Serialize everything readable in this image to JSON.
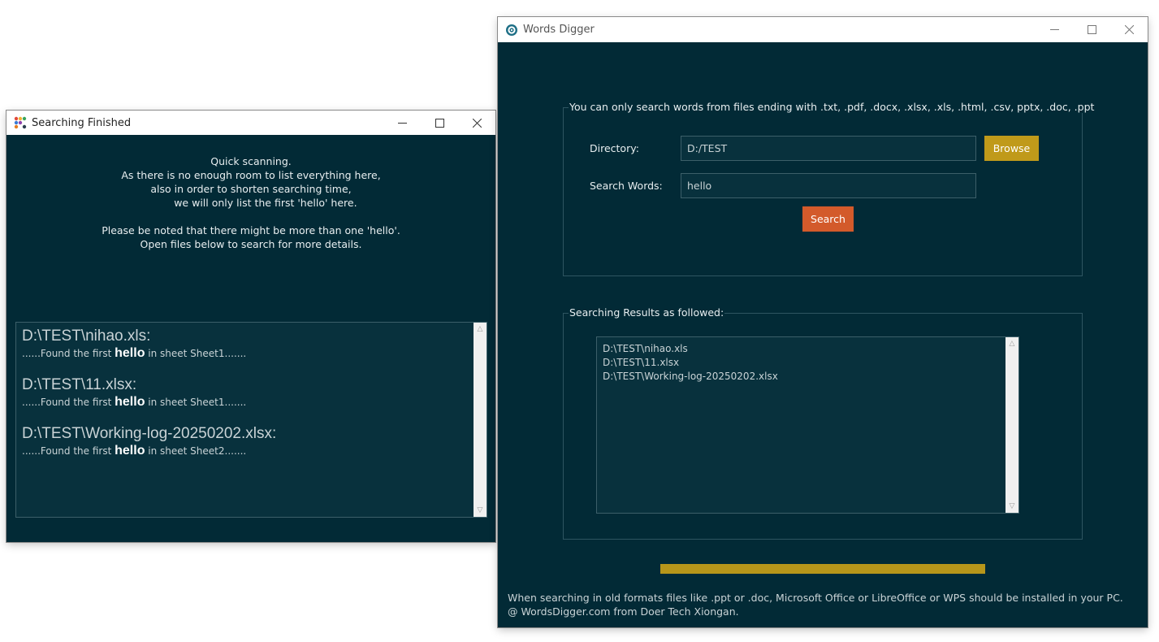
{
  "left_window": {
    "title": "Searching Finished",
    "notice_lines": [
      "Quick scanning.",
      "As there is no enough room to list everything here,",
      "also in order to shorten searching time,",
      "         we will only list the first 'hello' here.",
      "",
      "Please be noted that there might be more than one 'hello'.",
      "Open files below to search for more details."
    ],
    "results": [
      {
        "path": "D:\\TEST\\nihao.xls:",
        "prefix": "......Found the first ",
        "word": "hello",
        "suffix": " in sheet Sheet1......."
      },
      {
        "path": "D:\\TEST\\11.xlsx:",
        "prefix": "......Found the first ",
        "word": "hello",
        "suffix": " in sheet Sheet1......."
      },
      {
        "path": "D:\\TEST\\Working-log-20250202.xlsx:",
        "prefix": "......Found the first ",
        "word": "hello",
        "suffix": " in sheet Sheet2......."
      }
    ]
  },
  "right_window": {
    "title": "Words Digger",
    "search_group_title": "You can only search words from files ending with .txt, .pdf, .docx, .xlsx, .xls, .html, .csv, pptx, .doc, .ppt",
    "directory_label": "Directory:",
    "directory_value": "D:/TEST",
    "browse_label": "Browse",
    "search_words_label": "Search Words:",
    "search_words_value": "hello",
    "search_label": "Search",
    "results_group_title": "Searching Results as followed:",
    "results": [
      "D:\\TEST\\nihao.xls",
      "D:\\TEST\\11.xlsx",
      "D:\\TEST\\Working-log-20250202.xlsx"
    ],
    "progress": 1.0,
    "footer_lines": [
      "When searching in old formats files like .ppt or .doc, Microsoft Office or LibreOffice or WPS should be installed in your PC.",
      "@ WordsDigger.com from Doer Tech Xiongan."
    ]
  },
  "colors": {
    "background": "#022a36",
    "browse_button": "#c09a1a",
    "search_button": "#d35a2b",
    "progress_bar": "#b7961a"
  },
  "icons": {
    "left_app_icon": "colored-dots-icon",
    "right_app_icon": "gear-icon",
    "minimize": "minimize-icon",
    "maximize": "maximize-icon",
    "close": "close-icon"
  }
}
